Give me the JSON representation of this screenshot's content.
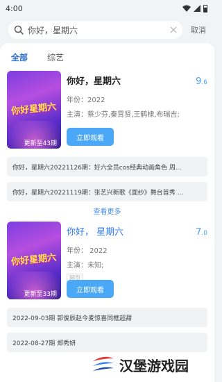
{
  "status": {
    "time": "4:00"
  },
  "search": {
    "value": "你好，星期六",
    "cancel_label": "取消"
  },
  "tabs": [
    {
      "label": "全部"
    },
    {
      "label": "综艺"
    }
  ],
  "results": [
    {
      "title": "你好，星期六",
      "score_int": "9",
      "score_dec": ".6",
      "poster_label": "你好星期六",
      "poster_badge": "更新至43期",
      "year": "年份：2022",
      "cast": "主演：蔡少芬,秦霄贤,王鹤棣,布瑞吉;",
      "watch_label": "立即观看",
      "episodes": [
        "你好，星期六20221126期：好六全员cos经典动画角色 周...",
        "你好，星期六20221119期：张艺兴新歌《面纱》舞台首秀 ..."
      ],
      "more_label": "查看更多"
    },
    {
      "title": "你好， 星期六",
      "score_int": "7",
      "score_dec": ".0",
      "poster_label": "你好星期六",
      "poster_badge": "更新至33期",
      "year": "年份： 2022",
      "cast": "主演：未知;",
      "tag": "网页",
      "watch_label": "立即观看",
      "episodes": [
        "2022-09-03期 郭俊辰赵今麦惊喜同框超甜",
        "2022-08-27期 郑秀妍"
      ]
    }
  ],
  "watermark": {
    "text": "汉堡游戏园"
  },
  "colors": {
    "accent": "#2f7cf6",
    "button": "#4aa8f7",
    "score": "#4aa0f0"
  }
}
